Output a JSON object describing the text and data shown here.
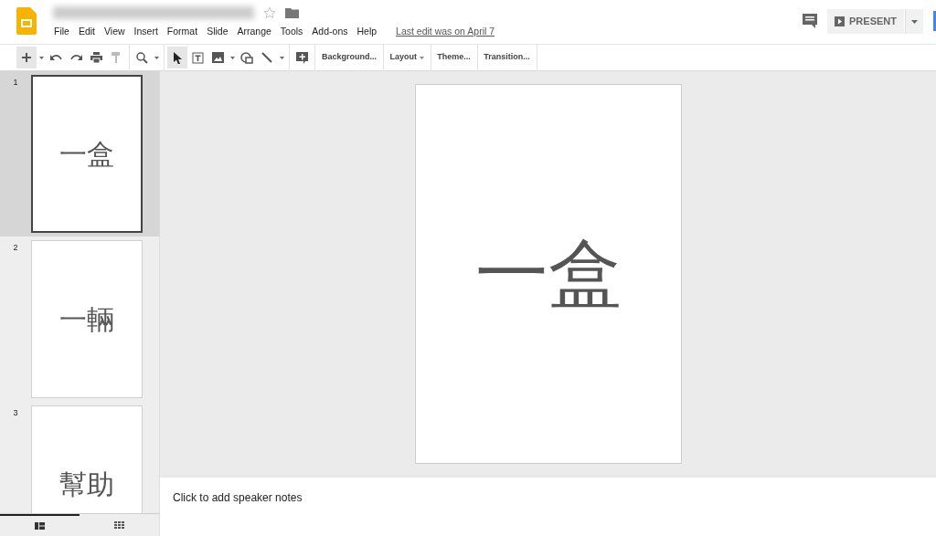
{
  "menu": [
    "File",
    "Edit",
    "View",
    "Insert",
    "Format",
    "Slide",
    "Arrange",
    "Tools",
    "Add-ons",
    "Help"
  ],
  "last_edit": "Last edit was on April 7",
  "present_button": "PRESENT",
  "toolbar": {
    "buttons": [
      "Background...",
      "Layout",
      "Theme...",
      "Transition..."
    ]
  },
  "slides": [
    {
      "number": "1",
      "text": "一盒",
      "selected": true
    },
    {
      "number": "2",
      "text": "一輛",
      "selected": false
    },
    {
      "number": "3",
      "text": "幫助",
      "selected": false
    }
  ],
  "view_tabs": [
    {
      "kind": "filmstrip",
      "selected": true
    },
    {
      "kind": "grid",
      "selected": false
    }
  ],
  "current_slide": {
    "text": "一盒"
  },
  "speaker_notes": {
    "placeholder": "Click to add speaker notes"
  }
}
